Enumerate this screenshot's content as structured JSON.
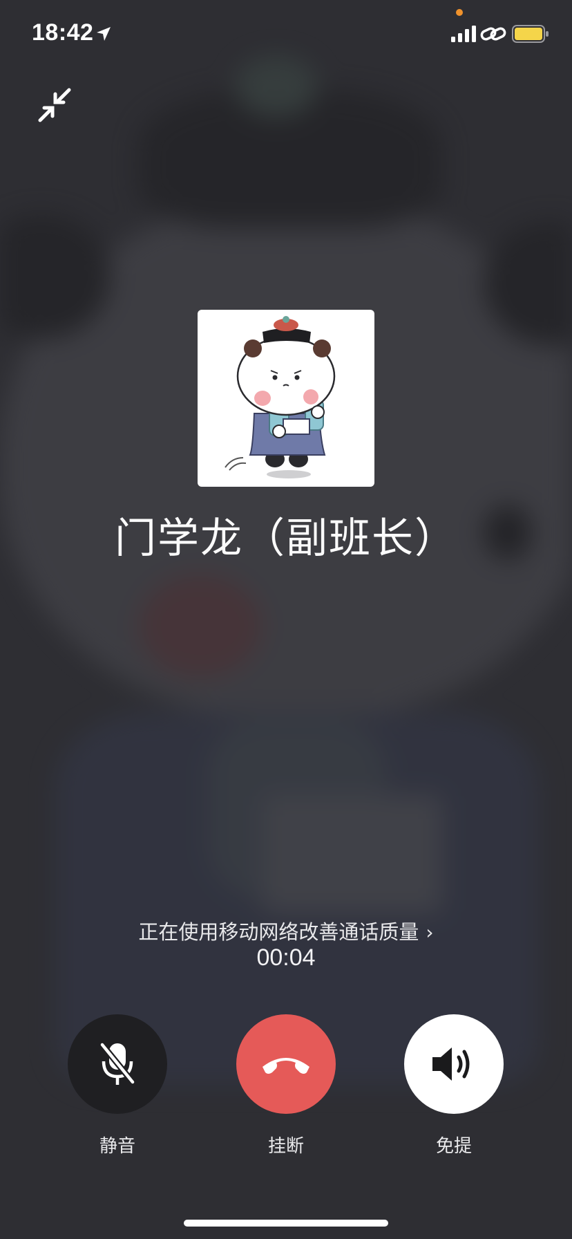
{
  "status_bar": {
    "time": "18:42",
    "icons": [
      "location-arrow-icon",
      "signal-icon",
      "link-icon",
      "battery-icon"
    ],
    "battery_color": "#f5d54a",
    "indicator_color": "#f0922c"
  },
  "call": {
    "caller_name": "门学龙（副班长）",
    "network_tip": "正在使用移动网络改善通话质量",
    "network_tip_chevron": "›",
    "duration": "00:04"
  },
  "controls": {
    "mute_label": "静音",
    "hangup_label": "挂断",
    "speaker_label": "免提",
    "hangup_color": "#e55a58"
  },
  "icons": {
    "minimize": "minimize-arrows-icon",
    "mute": "microphone-off-icon",
    "hangup": "phone-hangup-icon",
    "speaker": "speaker-icon"
  }
}
